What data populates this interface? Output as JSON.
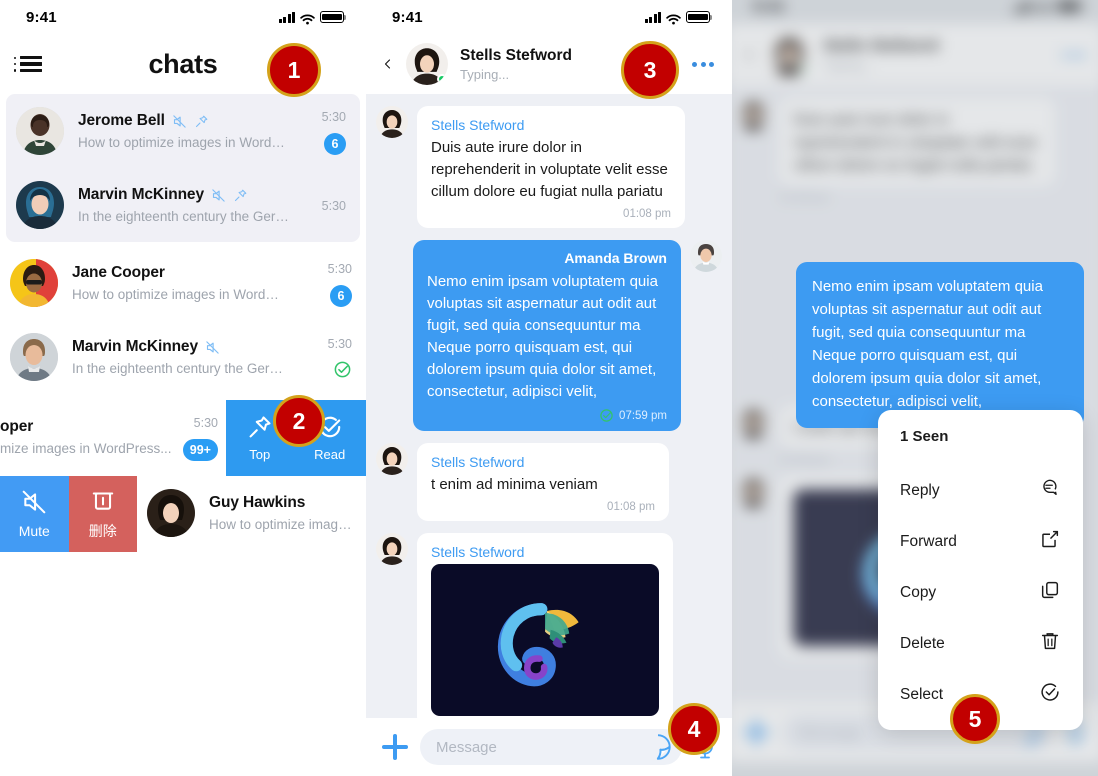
{
  "status_bar": {
    "time": "9:41",
    "icons": [
      "cellular-signal-icon",
      "wifi-icon",
      "battery-icon"
    ]
  },
  "colors": {
    "accent_blue": "#3d9bf2",
    "badge_blue": "#2a9df4",
    "swipe_blue": "#429bf4",
    "delete_red": "#d4615d",
    "pin_red": "#c20000",
    "pin_ring_gold": "#d4a21a",
    "read_green": "#17c964",
    "list_bg": "#eef0f5",
    "group_bg": "#f0f0f6",
    "attachment_bg": "#0a0b27"
  },
  "chats_panel": {
    "menu_icon": "list-menu-icon",
    "title": "chats",
    "rows": [
      {
        "name": "Jerome Bell",
        "muted": true,
        "pinned": true,
        "preview": "How to optimize images in WordPress for...",
        "time": "5:30",
        "badge": "6",
        "read": false,
        "grouped": true
      },
      {
        "name": "Marvin McKinney",
        "muted": true,
        "pinned": true,
        "preview": "In the eighteenth century the German philosoph...",
        "time": "5:30",
        "badge": "",
        "read": false,
        "grouped": true
      },
      {
        "name": "Jane Cooper",
        "muted": false,
        "pinned": false,
        "preview": "How to optimize images in WordPress for...",
        "time": "5:30",
        "badge": "6",
        "read": false,
        "grouped": false
      },
      {
        "name": "Marvin McKinney",
        "muted": true,
        "pinned": false,
        "preview": "In the eighteenth century the German philos...",
        "time": "5:30",
        "badge": "",
        "read": true,
        "grouped": false
      }
    ],
    "swipe_row_top": {
      "name_fragment": "oper",
      "preview_fragment": "mize images in WordPress...",
      "time": "5:30",
      "badge": "99+",
      "actions": [
        {
          "label": "Top",
          "icon": "pin-icon"
        },
        {
          "label": "Read",
          "icon": "check-circle-icon"
        }
      ]
    },
    "swipe_row_bottom": {
      "name": "Guy Hawkins",
      "preview": "How to optimize images in W",
      "actions": [
        {
          "label": "Mute",
          "icon": "mute-icon"
        },
        {
          "label": "删除",
          "icon": "trash-icon"
        }
      ]
    }
  },
  "conversation": {
    "header": {
      "back_icon": "chevron-left-icon",
      "name": "Stells Stefword",
      "status": "Typing...",
      "more_icon": "more-horizontal-icon",
      "online": true
    },
    "messages": [
      {
        "dir": "in",
        "name": "Stells Stefword",
        "text": "Duis aute irure dolor in reprehenderit in voluptate velit esse cillum dolore eu fugiat nulla pariatu",
        "time": "01:08 pm",
        "status": ""
      },
      {
        "dir": "out",
        "name": "Amanda Brown",
        "text": "Nemo enim ipsam voluptatem quia voluptas sit aspernatur aut odit aut fugit, sed quia consequuntur ma Neque porro quisquam est, qui dolorem ipsum quia dolor sit amet, consectetur, adipisci velit,",
        "time": "07:59 pm",
        "status": "read"
      },
      {
        "dir": "in",
        "name": "Stells Stefword",
        "text": "t enim ad minima veniam",
        "time": "01:08 pm",
        "status": ""
      },
      {
        "dir": "in",
        "name": "Stells Stefword",
        "text": "",
        "attachment": "chameleon-logo-image",
        "time": "",
        "status": ""
      }
    ],
    "composer": {
      "plus_icon": "plus-icon",
      "placeholder": "Message",
      "sticker_icon": "sticker-icon",
      "mic_icon": "microphone-icon"
    }
  },
  "context_menu": {
    "seen_label": "1 Seen",
    "highlighted_message": "Nemo enim ipsam voluptatem quia voluptas sit aspernatur aut odit aut fugit, sed quia consequuntur ma Neque porro quisquam est, qui dolorem ipsum quia dolor sit amet, consectetur, adipisci velit,",
    "items": [
      {
        "label": "Reply",
        "icon": "reply-bubble-icon"
      },
      {
        "label": "Forward",
        "icon": "forward-share-icon"
      },
      {
        "label": "Copy",
        "icon": "copy-icon"
      },
      {
        "label": "Delete",
        "icon": "trash-icon"
      },
      {
        "label": "Select",
        "icon": "check-circle-icon"
      }
    ]
  },
  "annotations": [
    {
      "number": "1"
    },
    {
      "number": "2"
    },
    {
      "number": "3"
    },
    {
      "number": "4"
    },
    {
      "number": "5"
    }
  ]
}
